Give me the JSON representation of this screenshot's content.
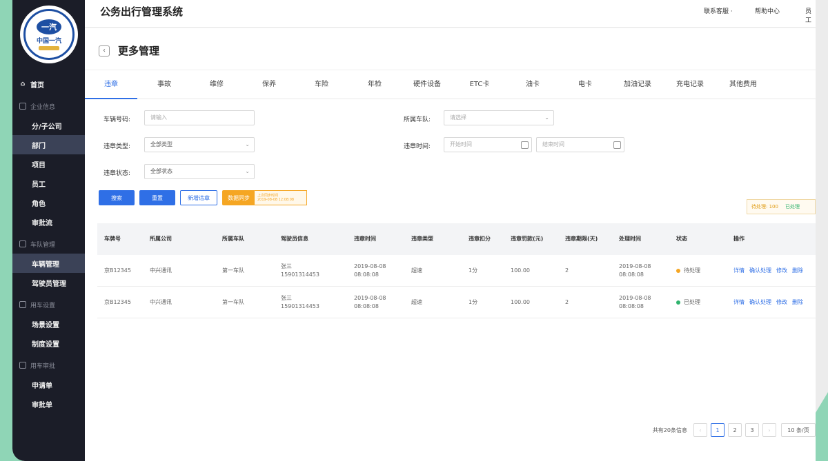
{
  "app": {
    "title": "公务出行管理系统"
  },
  "header": {
    "links": [
      "联系客服 ·",
      "帮助中心",
      "员工"
    ]
  },
  "logo": {
    "mark": "一汽",
    "text": "中国一汽"
  },
  "sidebar": {
    "home": "首页",
    "groups": [
      {
        "label": "企业信息",
        "items": [
          "分/子公司",
          "部门",
          "项目",
          "员工",
          "角色",
          "审批流"
        ]
      },
      {
        "label": "车队管理",
        "items": [
          "车辆管理",
          "驾驶员管理"
        ]
      },
      {
        "label": "用车设置",
        "items": [
          "场景设置",
          "制度设置"
        ]
      },
      {
        "label": "用车审批",
        "items": [
          "申请单",
          "审批单"
        ]
      }
    ]
  },
  "page": {
    "title": "更多管理",
    "back": "‹"
  },
  "tabs": [
    "违章",
    "事故",
    "维修",
    "保养",
    "车险",
    "年检",
    "硬件设备",
    "ETC卡",
    "油卡",
    "电卡",
    "加油记录",
    "充电记录",
    "其他费用"
  ],
  "filters": {
    "plate_label": "车辆号码:",
    "plate_placeholder": "请输入",
    "fleet_label": "所属车队:",
    "fleet_placeholder": "请选择",
    "type_label": "违章类型:",
    "type_value": "全部类型",
    "time_label": "违章时间:",
    "time_start": "开始时间",
    "time_end": "结束时间",
    "status_label": "违章状态:",
    "status_value": "全部状态"
  },
  "buttons": {
    "search": "搜索",
    "reset": "重置",
    "add": "新增违章",
    "sync": "数据同步",
    "sync_note_1": "上次同步时间",
    "sync_note_2": "2019-08-08 12:08:08"
  },
  "stats": {
    "pending": "待处理: 100",
    "done": "已处理"
  },
  "table": {
    "headers": [
      "车牌号",
      "所属公司",
      "所属车队",
      "驾驶员信息",
      "违章时间",
      "违章类型",
      "违章扣分",
      "违章罚款(元)",
      "违章期限(天)",
      "处理时间",
      "状态",
      "操作"
    ],
    "rows": [
      {
        "plate": "京B12345",
        "company": "中兴通讯",
        "fleet": "第一车队",
        "driver_name": "张三",
        "driver_phone": "15901314453",
        "time_date": "2019-08-08",
        "time_clock": "08:08:08",
        "type": "超速",
        "points": "1分",
        "fine": "100.00",
        "days": "2",
        "handle_date": "2019-08-08",
        "handle_clock": "08:08:08",
        "status": "待处理",
        "status_color": "#f5a623"
      },
      {
        "plate": "京B12345",
        "company": "中兴通讯",
        "fleet": "第一车队",
        "driver_name": "张三",
        "driver_phone": "15901314453",
        "time_date": "2019-08-08",
        "time_clock": "08:08:08",
        "type": "超速",
        "points": "1分",
        "fine": "100.00",
        "days": "2",
        "handle_date": "2019-08-08",
        "handle_clock": "08:08:08",
        "status": "已处理",
        "status_color": "#2fb36d"
      }
    ],
    "ops": [
      "详情",
      "确认处理",
      "修改",
      "删除"
    ]
  },
  "pager": {
    "total": "共有20条信息",
    "prev": "‹",
    "pages": [
      "1",
      "2",
      "3"
    ],
    "next": "›",
    "size": "10 条/页"
  }
}
